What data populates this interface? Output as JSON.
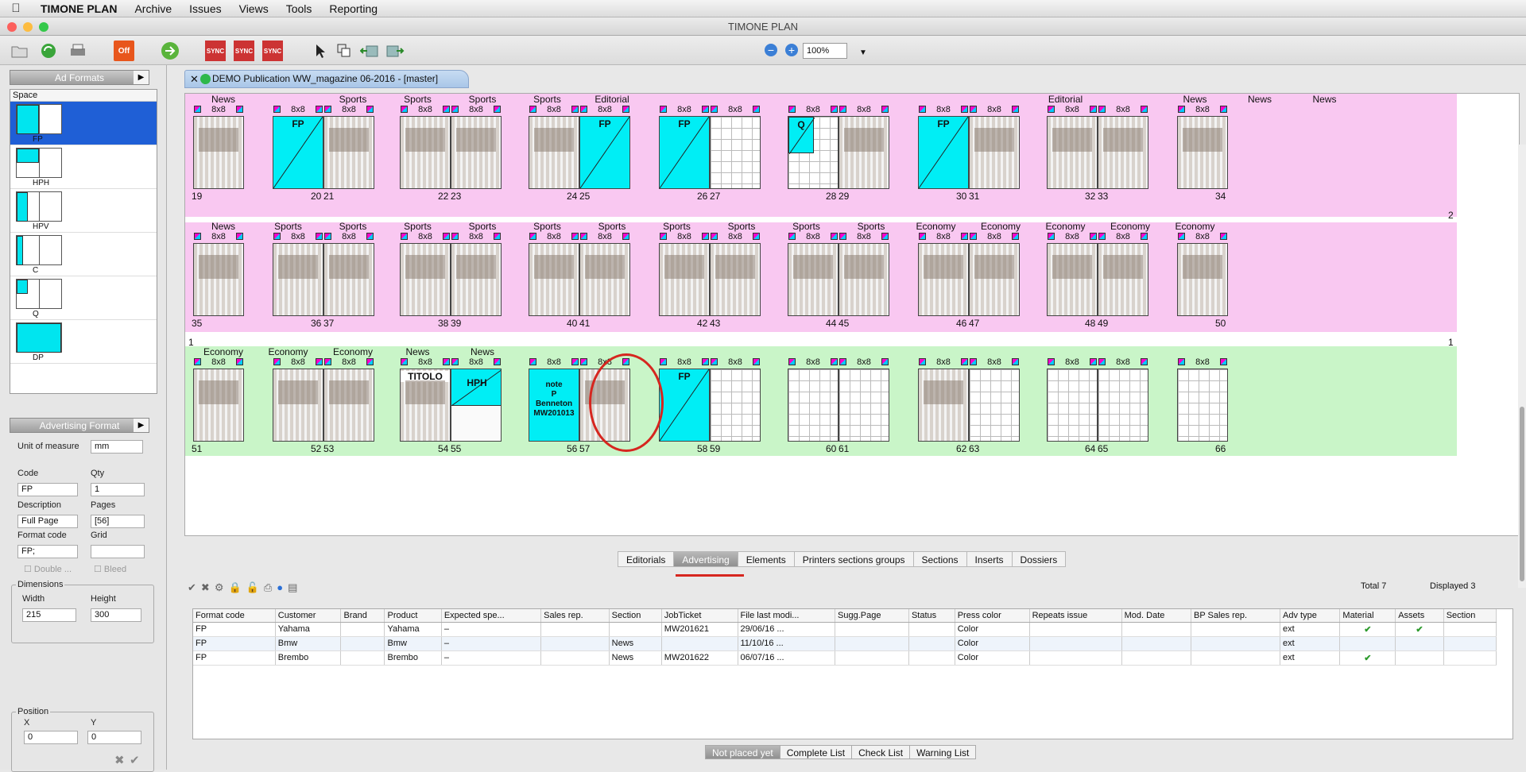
{
  "menubar": {
    "app": "TIMONE PLAN",
    "items": [
      "Archive",
      "Issues",
      "Views",
      "Tools",
      "Reporting"
    ]
  },
  "window_title": "TIMONE PLAN",
  "toolbar": {
    "zoom": "100%",
    "off_label": "Off",
    "sync_label": "SYNC"
  },
  "ad_formats": {
    "title": "Ad Formats",
    "col": "Space",
    "items": [
      "FP",
      "HPH",
      "HPV",
      "C",
      "Q",
      "DP"
    ]
  },
  "adv_format": {
    "title": "Advertising Format",
    "unit_label": "Unit of measure",
    "unit": "mm",
    "code_label": "Code",
    "code": "FP",
    "qty_label": "Qty",
    "qty": "1",
    "desc_label": "Description",
    "desc": "Full Page",
    "pages_label": "Pages",
    "pages": "[56]",
    "fcode_label": "Format code",
    "fcode": "FP;",
    "grid_label": "Grid",
    "grid": "",
    "double_label": "Double ...",
    "bleed_label": "Bleed",
    "dims_label": "Dimensions",
    "width_label": "Width",
    "width": "215",
    "height_label": "Height",
    "height": "300",
    "pos_label": "Position",
    "x_label": "X",
    "x": "0",
    "y_label": "Y",
    "y": "0"
  },
  "doc_tab": "DEMO Publication WW_magazine 06-2016 - [master]",
  "rows": [
    {
      "sections": [
        "News",
        "",
        "Sports",
        "Sports",
        "Sports",
        "Sports",
        "Editorial",
        "",
        "",
        "",
        "",
        "",
        "",
        "Editorial",
        "",
        "News",
        "News",
        "News"
      ],
      "pages": [
        "19",
        "20",
        "21",
        "22",
        "23",
        "24",
        "25",
        "26",
        "27",
        "28",
        "29",
        "30",
        "31",
        "32",
        "33",
        "34"
      ]
    },
    {
      "sections": [
        "News",
        "Sports",
        "Sports",
        "Sports",
        "Sports",
        "Sports",
        "Sports",
        "Sports",
        "Sports",
        "Sports",
        "Sports",
        "Economy",
        "Economy",
        "Economy",
        "Economy",
        "Economy"
      ],
      "pages": [
        "35",
        "36",
        "37",
        "38",
        "39",
        "40",
        "41",
        "42",
        "43",
        "44",
        "45",
        "46",
        "47",
        "48",
        "49",
        "50"
      ],
      "marker_left": "1",
      "marker_right": "1",
      "marker_top": "2"
    },
    {
      "sections": [
        "Economy",
        "Economy",
        "Economy",
        "News",
        "News"
      ],
      "pages": [
        "51",
        "52",
        "53",
        "54",
        "55",
        "56",
        "57",
        "58",
        "59",
        "60",
        "61",
        "62",
        "63",
        "64",
        "65",
        "66"
      ]
    }
  ],
  "tag_label": "8x8",
  "page_labels": {
    "fp": "FP",
    "q": "Q",
    "hph": "HPH",
    "titolo": "TITOLO"
  },
  "highlight_note": [
    "note",
    "P",
    "Benneton",
    "MW201013"
  ],
  "bottom_tabs": [
    "Editorials",
    "Advertising",
    "Elements",
    "Printers sections groups",
    "Sections",
    "Inserts",
    "Dossiers"
  ],
  "totals": {
    "total": "Total 7",
    "displayed": "Displayed 3"
  },
  "table": {
    "headers": [
      "Format code",
      "Customer",
      "Brand",
      "Product",
      "Expected spe...",
      "Sales rep.",
      "Section",
      "JobTicket",
      "File last modi...",
      "Sugg.Page",
      "Status",
      "Press color",
      "Repeats issue",
      "Mod. Date",
      "BP Sales rep.",
      "Adv type",
      "Material",
      "Assets",
      "Section"
    ],
    "rows": [
      [
        "FP",
        "Yahama",
        "",
        "Yahama",
        "–",
        "",
        "",
        "MW201621",
        "29/06/16 ...",
        "",
        "",
        "Color",
        "",
        "",
        "",
        "ext",
        "✔",
        "✔",
        ""
      ],
      [
        "FP",
        "Bmw",
        "",
        "Bmw",
        "–",
        "",
        "News",
        "",
        "11/10/16 ...",
        "",
        "",
        "Color",
        "",
        "",
        "",
        "ext",
        "",
        "",
        ""
      ],
      [
        "FP",
        "Brembo",
        "",
        "Brembo",
        "–",
        "",
        "News",
        "MW201622",
        "06/07/16 ...",
        "",
        "",
        "Color",
        "",
        "",
        "",
        "ext",
        "✔",
        "",
        ""
      ]
    ]
  },
  "bottom_buttons": [
    "Not placed yet",
    "Complete List",
    "Check List",
    "Warning List"
  ]
}
